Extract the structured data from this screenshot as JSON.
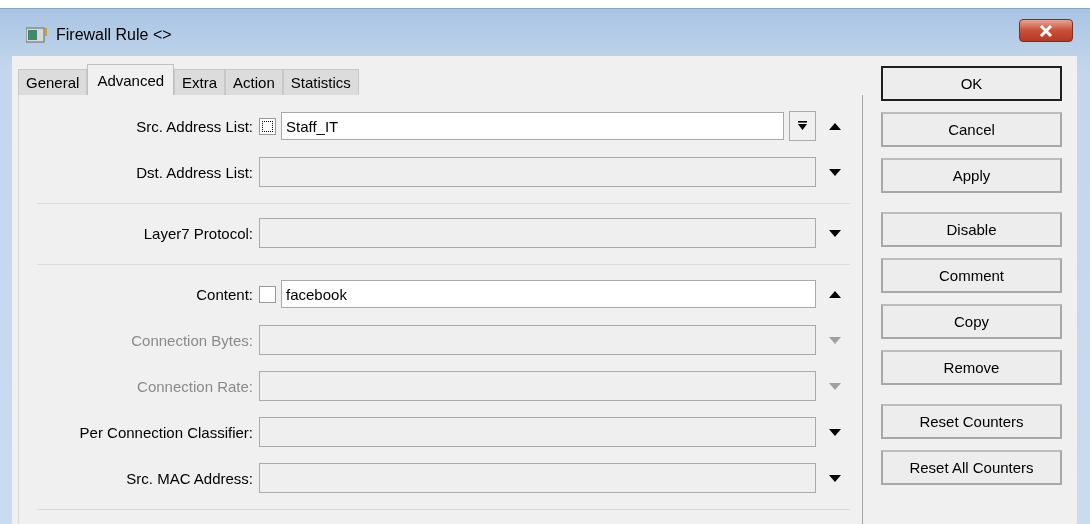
{
  "window": {
    "title": "Firewall Rule <>"
  },
  "tabs": [
    {
      "label": "General",
      "selected": false
    },
    {
      "label": "Advanced",
      "selected": true
    },
    {
      "label": "Extra",
      "selected": false
    },
    {
      "label": "Action",
      "selected": false
    },
    {
      "label": "Statistics",
      "selected": false
    }
  ],
  "sections": [
    {
      "fields": [
        {
          "label": "Src. Address List:",
          "kind": "list",
          "checked": false,
          "focused": true,
          "value": "Staff_IT",
          "disabled": false,
          "expanded": true
        },
        {
          "label": "Dst. Address List:",
          "kind": "combo",
          "disabled": false,
          "expanded": false
        }
      ]
    },
    {
      "fields": [
        {
          "label": "Layer7 Protocol:",
          "kind": "combo",
          "disabled": false,
          "expanded": false
        }
      ]
    },
    {
      "fields": [
        {
          "label": "Content:",
          "kind": "text",
          "checked": false,
          "value": "facebook",
          "disabled": false,
          "expanded": true
        },
        {
          "label": "Connection Bytes:",
          "kind": "combo",
          "disabled": true,
          "expanded": false
        },
        {
          "label": "Connection Rate:",
          "kind": "combo",
          "disabled": true,
          "expanded": false
        },
        {
          "label": "Per Connection Classifier:",
          "kind": "combo",
          "disabled": false,
          "expanded": false
        },
        {
          "label": "Src. MAC Address:",
          "kind": "combo",
          "disabled": false,
          "expanded": false
        }
      ]
    }
  ],
  "button_groups": [
    [
      {
        "label": "OK",
        "default": true
      },
      {
        "label": "Cancel",
        "default": false
      },
      {
        "label": "Apply",
        "default": false
      }
    ],
    [
      {
        "label": "Disable",
        "default": false
      },
      {
        "label": "Comment",
        "default": false
      },
      {
        "label": "Copy",
        "default": false
      },
      {
        "label": "Remove",
        "default": false
      }
    ],
    [
      {
        "label": "Reset Counters",
        "default": false
      },
      {
        "label": "Reset All Counters",
        "default": false
      }
    ]
  ]
}
